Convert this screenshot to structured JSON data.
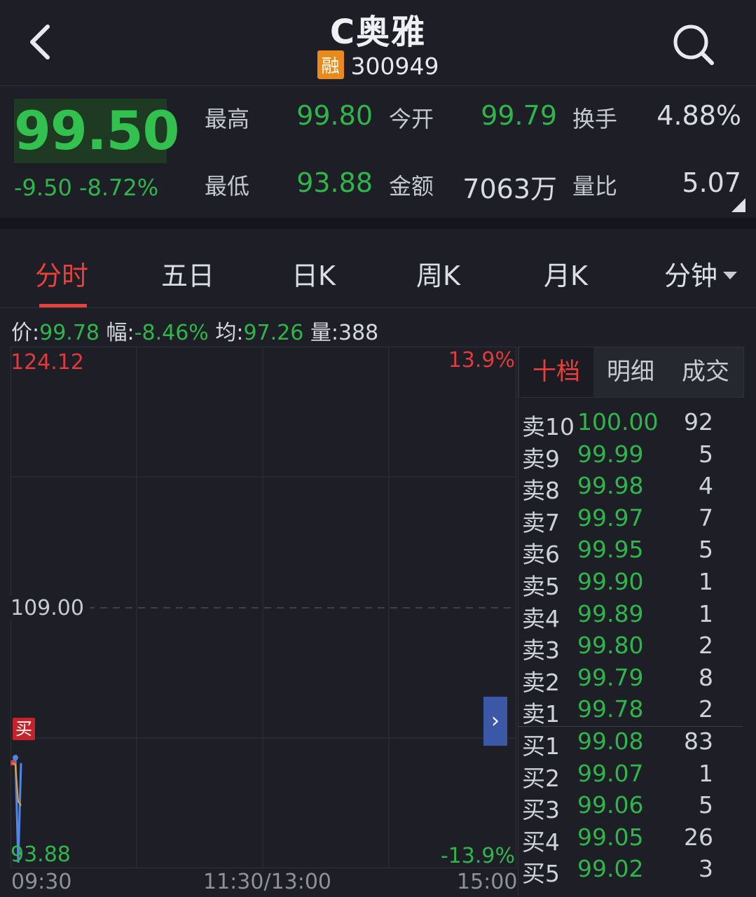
{
  "header": {
    "title": "C奥雅",
    "margin_badge": "融",
    "code": "300949"
  },
  "quote": {
    "price": "99.50",
    "change": "-9.50 -8.72%",
    "high_label": "最高",
    "high": "99.80",
    "open_label": "今开",
    "open": "99.79",
    "turnover_label": "换手",
    "turnover": "4.88%",
    "low_label": "最低",
    "low": "93.88",
    "amount_label": "金额",
    "amount": "7063万",
    "volume_ratio_label": "量比",
    "volume_ratio": "5.07"
  },
  "tabs": [
    "分时",
    "五日",
    "日K",
    "周K",
    "月K",
    "分钟"
  ],
  "infobar": {
    "price_label": "价:",
    "price": "99.78",
    "amp_label": "幅:",
    "amp": "-8.46%",
    "avg_label": "均:",
    "avg": "97.26",
    "vol_label": "量:",
    "vol": "388"
  },
  "chart": {
    "y_top": "124.12",
    "y_mid": "109.00",
    "y_bottom": "93.88",
    "pct_top": "13.9%",
    "pct_bottom": "-13.9%",
    "times": [
      "09:30",
      "11:30/13:00",
      "15:00"
    ],
    "buy_marker": "买",
    "expand": "›"
  },
  "chart_data": {
    "type": "line",
    "title": "",
    "xlabel": "",
    "ylabel": "",
    "ylim": [
      93.88,
      124.12
    ],
    "reference_price": 109.0,
    "series": [
      {
        "x": [
          0,
          1,
          2,
          3
        ],
        "values": [
          99.8,
          100.1,
          93.88,
          99.78
        ],
        "color": "#4f86e8"
      },
      {
        "x": [
          0,
          1,
          2,
          3
        ],
        "values": [
          99.79,
          99.7,
          97.5,
          97.26
        ],
        "color": "#e6a52a"
      }
    ]
  },
  "orderbook": {
    "tabs": [
      "十档",
      "明细",
      "成交"
    ],
    "asks": [
      {
        "label": "卖10",
        "price": "100.00",
        "vol": "92"
      },
      {
        "label": "卖9",
        "price": "99.99",
        "vol": "5"
      },
      {
        "label": "卖8",
        "price": "99.98",
        "vol": "4"
      },
      {
        "label": "卖7",
        "price": "99.97",
        "vol": "7"
      },
      {
        "label": "卖6",
        "price": "99.95",
        "vol": "5"
      },
      {
        "label": "卖5",
        "price": "99.90",
        "vol": "1"
      },
      {
        "label": "卖4",
        "price": "99.89",
        "vol": "1"
      },
      {
        "label": "卖3",
        "price": "99.80",
        "vol": "2"
      },
      {
        "label": "卖2",
        "price": "99.79",
        "vol": "8"
      },
      {
        "label": "卖1",
        "price": "99.78",
        "vol": "2"
      }
    ],
    "bids": [
      {
        "label": "买1",
        "price": "99.08",
        "vol": "83"
      },
      {
        "label": "买2",
        "price": "99.07",
        "vol": "1"
      },
      {
        "label": "买3",
        "price": "99.06",
        "vol": "5"
      },
      {
        "label": "买4",
        "price": "99.05",
        "vol": "26"
      },
      {
        "label": "买5",
        "price": "99.02",
        "vol": "3"
      }
    ]
  },
  "colors": {
    "up": "#e23a3a",
    "down": "#2fb64a",
    "accent": "#e8403a",
    "price_line": "#4f86e8",
    "avg_line": "#e6a52a"
  }
}
